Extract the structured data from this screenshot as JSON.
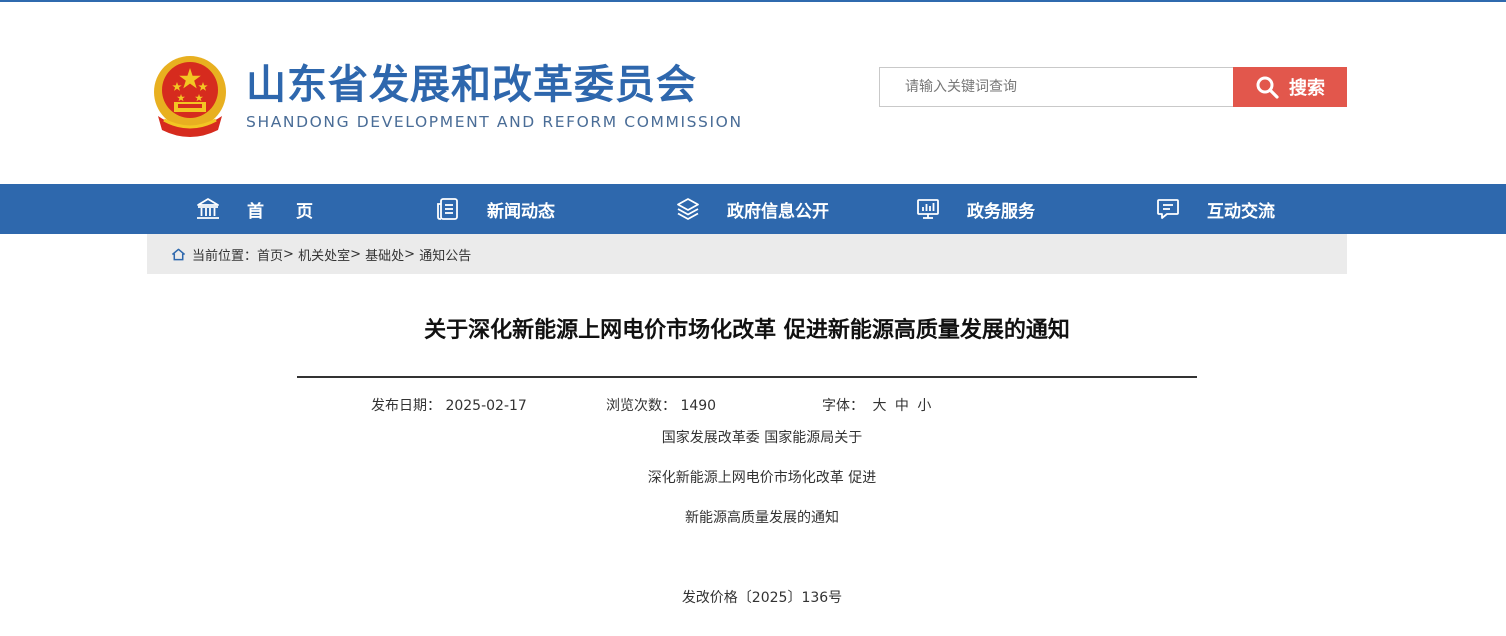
{
  "header": {
    "site_title": "山东省发展和改革委员会",
    "site_subtitle": "SHANDONG DEVELOPMENT AND REFORM COMMISSION",
    "search": {
      "placeholder": "请输入关键词查询",
      "value": "",
      "button_label": "搜索"
    }
  },
  "nav": {
    "items": [
      {
        "label": "首页",
        "icon": "building-icon"
      },
      {
        "label": "新闻动态",
        "icon": "document-icon"
      },
      {
        "label": "政府信息公开",
        "icon": "layers-icon"
      },
      {
        "label": "政务服务",
        "icon": "monitor-chart-icon"
      },
      {
        "label": "互动交流",
        "icon": "chat-icon"
      }
    ]
  },
  "breadcrumb": {
    "prefix": "当前位置：",
    "items": [
      "首页",
      "机关处室",
      "基础处",
      "通知公告"
    ],
    "separator": ">"
  },
  "article": {
    "title": "关于深化新能源上网电价市场化改革 促进新能源高质量发展的通知",
    "meta": {
      "date_label": "发布日期：",
      "date_value": "2025-02-17",
      "views_label": "浏览次数：",
      "views_value": "1490",
      "font_label": "字体：",
      "font_options": [
        "大",
        "中",
        "小"
      ]
    },
    "body_lines": [
      "国家发展改革委 国家能源局关于",
      "深化新能源上网电价市场化改革 促进",
      "新能源高质量发展的通知",
      "发改价格〔2025〕136号"
    ]
  },
  "colors": {
    "brand_blue": "#2e68ad",
    "search_red": "#e2574c",
    "breadcrumb_bg": "#ebebeb"
  }
}
